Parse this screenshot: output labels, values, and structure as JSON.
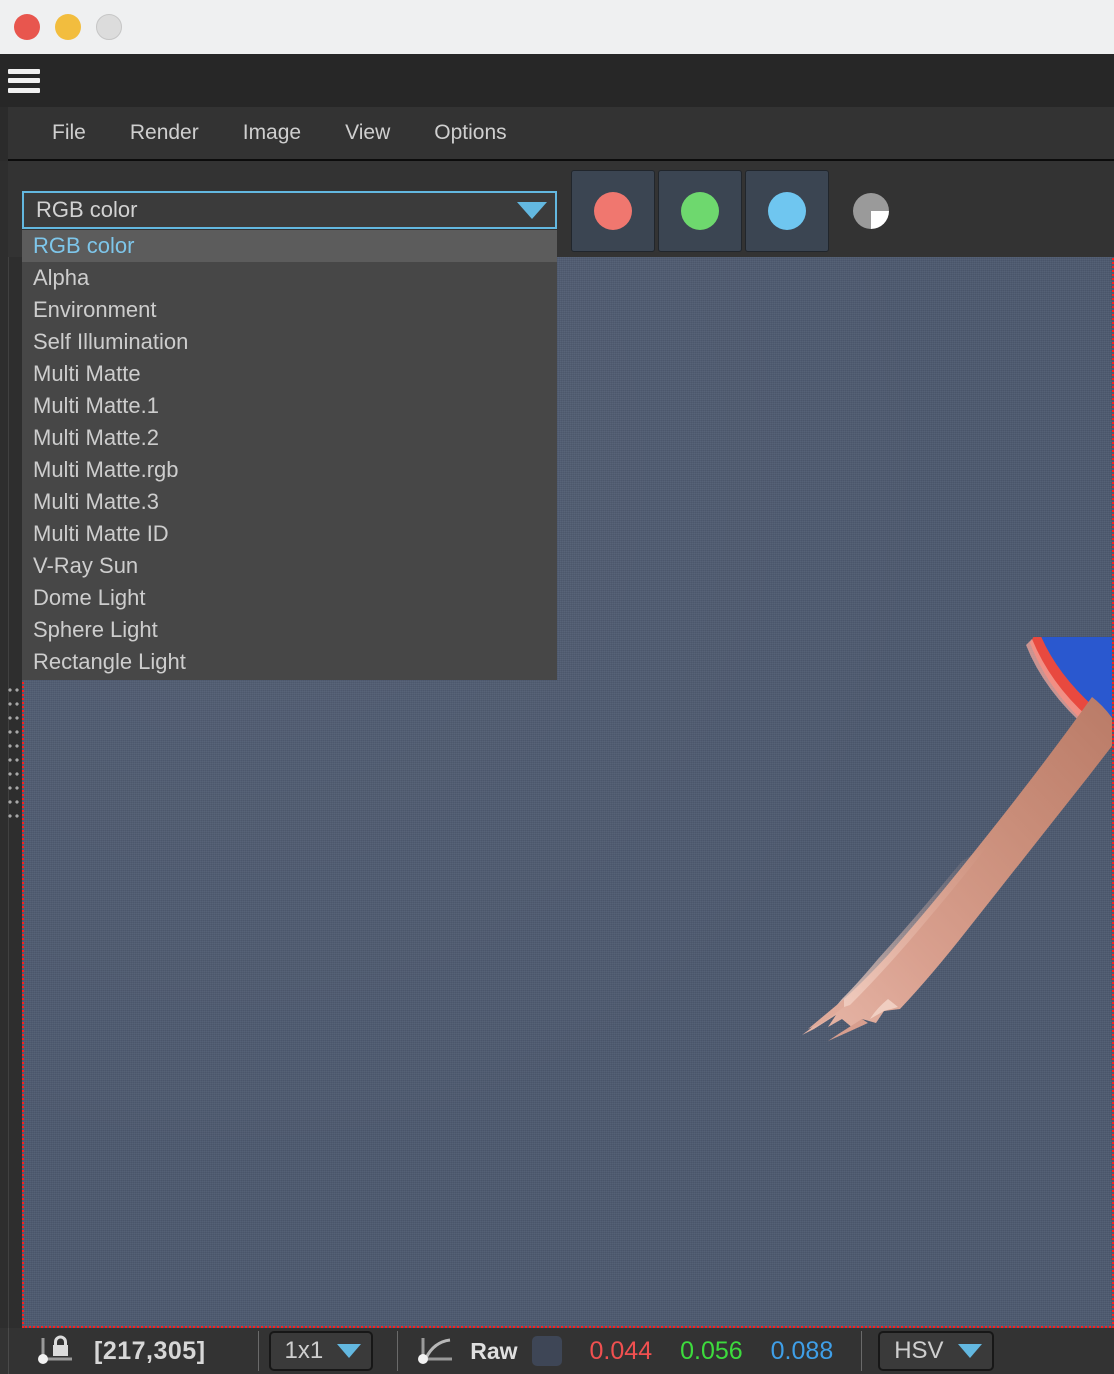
{
  "window": {
    "traffic_lights": [
      "close",
      "minimize",
      "zoom"
    ],
    "hamburger_icon": "hamburger-icon"
  },
  "menubar": {
    "items": [
      {
        "label": "File"
      },
      {
        "label": "Render"
      },
      {
        "label": "Image"
      },
      {
        "label": "View"
      },
      {
        "label": "Options"
      }
    ]
  },
  "toolbar": {
    "channel_select": {
      "value": "RGB color",
      "expanded": true,
      "arrow_icon": "chevron-down-icon",
      "accent_color": "#63b8e0",
      "options": [
        "RGB color",
        "Alpha",
        "Environment",
        "Self Illumination",
        "Multi Matte",
        "Multi Matte.1",
        "Multi Matte.2",
        "Multi Matte.rgb",
        "Multi Matte.3",
        "Multi Matte ID",
        "V-Ray Sun",
        "Dome Light",
        "Sphere Light",
        "Rectangle Light"
      ],
      "selected_option": "RGB color"
    },
    "channel_buttons": [
      {
        "name": "red-channel-button",
        "icon": "red-circle-icon",
        "color": "#f0776f",
        "active": true
      },
      {
        "name": "green-channel-button",
        "icon": "green-circle-icon",
        "color": "#6ed86e",
        "active": true
      },
      {
        "name": "blue-channel-button",
        "icon": "blue-circle-icon",
        "color": "#6fc6f0",
        "active": true
      }
    ],
    "alpha_button": {
      "name": "alpha-channel-button",
      "icon": "checker-circle-icon",
      "active": false
    }
  },
  "canvas": {
    "region_border_color": "#ff1c1c",
    "background_color": "#4e5a70",
    "subject": "outstretched arm and hand of a diver in blue and red swimwear"
  },
  "statusbar": {
    "pixel_lock_icon": "pixel-lock-icon",
    "coordinates": "[217,305]",
    "sample_size": {
      "value": "1x1",
      "arrow_icon": "chevron-down-icon"
    },
    "curve_icon": "gamma-curve-icon",
    "mode_label": "Raw",
    "sampled_color": "#3e4656",
    "values": {
      "r": "0.044",
      "g": "0.056",
      "b": "0.088"
    },
    "color_space": {
      "value": "HSV",
      "arrow_icon": "chevron-down-icon"
    }
  }
}
